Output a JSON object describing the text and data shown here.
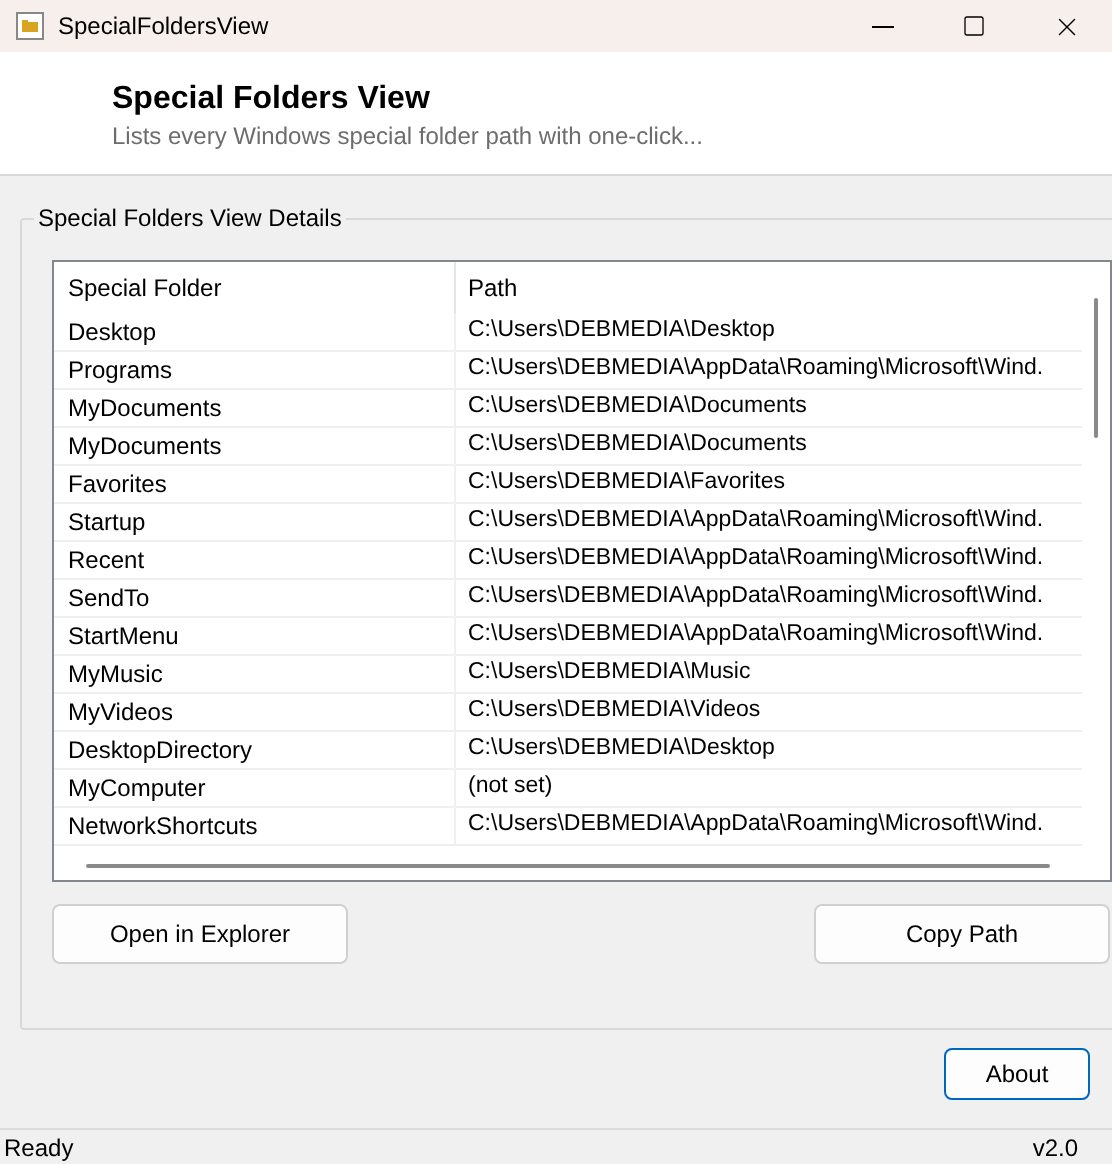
{
  "window": {
    "title": "SpecialFoldersView"
  },
  "header": {
    "title": "Special Folders View",
    "subtitle": "Lists every Windows special folder path with one-click..."
  },
  "group": {
    "title": "Special Folders View Details"
  },
  "table": {
    "columns": [
      "Special Folder",
      "Path"
    ],
    "rows": [
      {
        "folder": "Desktop",
        "path": "C:\\Users\\DEBMEDIA\\Desktop"
      },
      {
        "folder": "Programs",
        "path": "C:\\Users\\DEBMEDIA\\AppData\\Roaming\\Microsoft\\Wind."
      },
      {
        "folder": "MyDocuments",
        "path": "C:\\Users\\DEBMEDIA\\Documents"
      },
      {
        "folder": "MyDocuments",
        "path": "C:\\Users\\DEBMEDIA\\Documents"
      },
      {
        "folder": "Favorites",
        "path": "C:\\Users\\DEBMEDIA\\Favorites"
      },
      {
        "folder": "Startup",
        "path": "C:\\Users\\DEBMEDIA\\AppData\\Roaming\\Microsoft\\Wind."
      },
      {
        "folder": "Recent",
        "path": "C:\\Users\\DEBMEDIA\\AppData\\Roaming\\Microsoft\\Wind."
      },
      {
        "folder": "SendTo",
        "path": "C:\\Users\\DEBMEDIA\\AppData\\Roaming\\Microsoft\\Wind."
      },
      {
        "folder": "StartMenu",
        "path": "C:\\Users\\DEBMEDIA\\AppData\\Roaming\\Microsoft\\Wind."
      },
      {
        "folder": "MyMusic",
        "path": "C:\\Users\\DEBMEDIA\\Music"
      },
      {
        "folder": "MyVideos",
        "path": "C:\\Users\\DEBMEDIA\\Videos"
      },
      {
        "folder": "DesktopDirectory",
        "path": "C:\\Users\\DEBMEDIA\\Desktop"
      },
      {
        "folder": "MyComputer",
        "path": "(not set)"
      },
      {
        "folder": "NetworkShortcuts",
        "path": "C:\\Users\\DEBMEDIA\\AppData\\Roaming\\Microsoft\\Wind."
      }
    ]
  },
  "buttons": {
    "open": "Open in Explorer",
    "copy": "Copy Path",
    "about": "About"
  },
  "status_bar": {
    "text": "Ready",
    "version": "v2.0"
  }
}
